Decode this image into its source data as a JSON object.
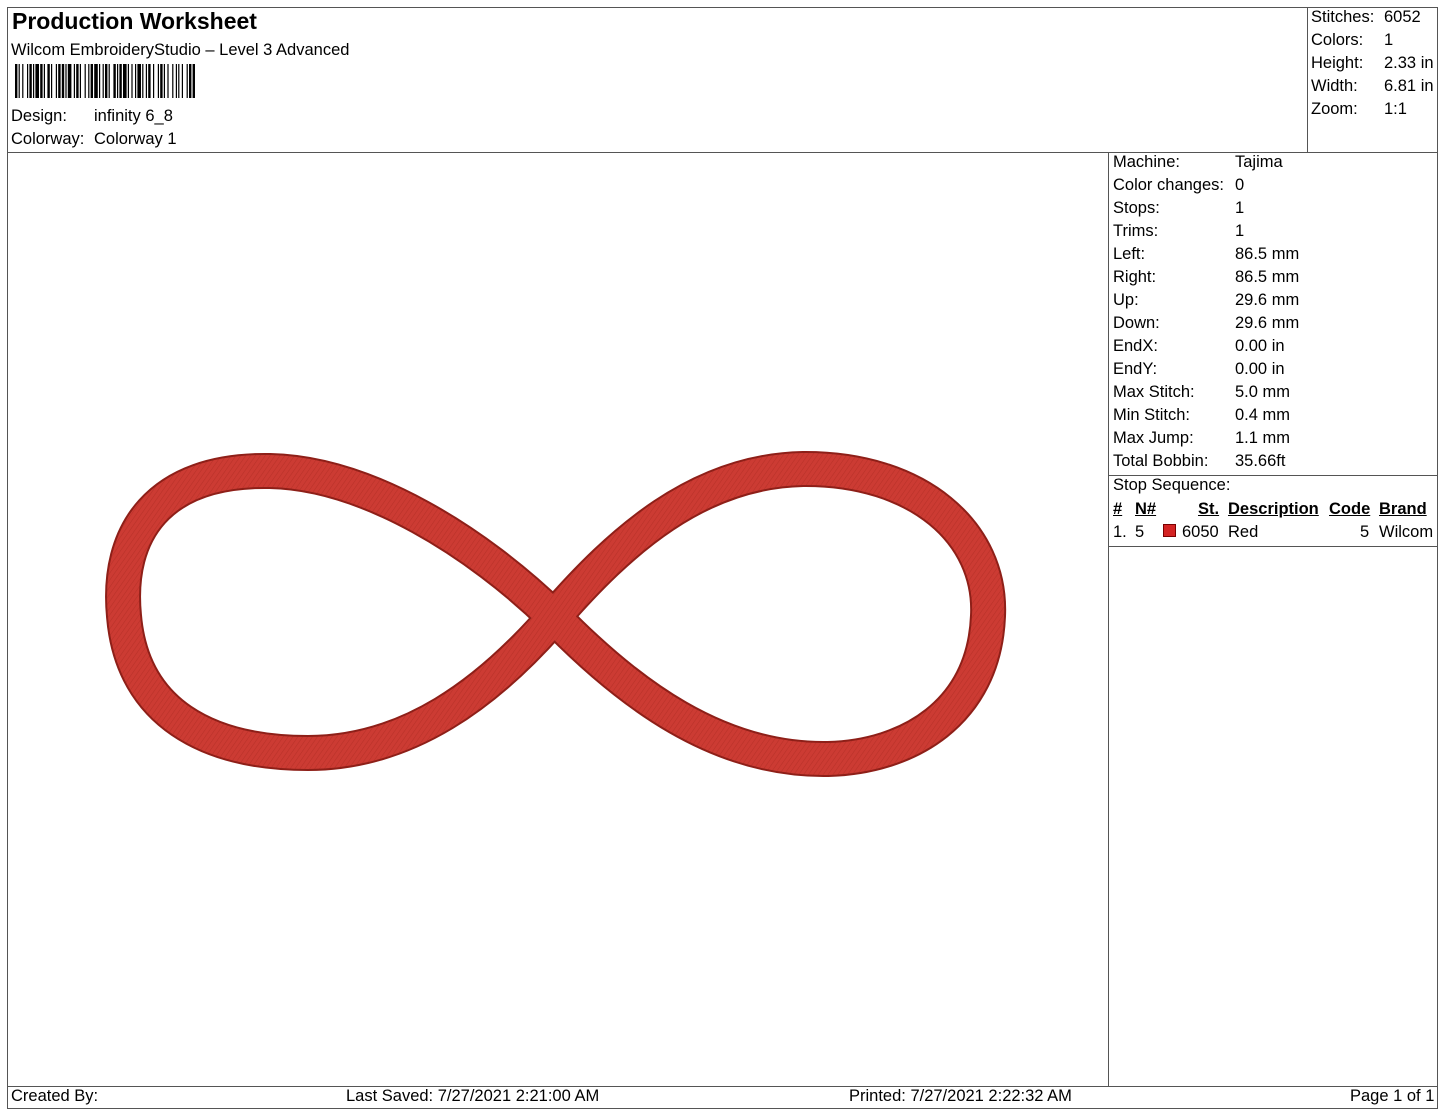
{
  "header": {
    "title": "Production Worksheet",
    "subtitle": "Wilcom EmbroideryStudio – Level 3 Advanced",
    "design_label": "Design:",
    "design_value": "infinity 6_8",
    "colorway_label": "Colorway:",
    "colorway_value": "Colorway 1"
  },
  "summary": [
    {
      "label": "Stitches:",
      "value": "6052"
    },
    {
      "label": "Colors:",
      "value": "1"
    },
    {
      "label": "Height:",
      "value": "2.33 in"
    },
    {
      "label": "Width:",
      "value": "6.81 in"
    },
    {
      "label": "Zoom:",
      "value": "1:1"
    }
  ],
  "details": [
    {
      "label": "Machine:",
      "value": "Tajima"
    },
    {
      "label": "Color changes:",
      "value": "0"
    },
    {
      "label": "Stops:",
      "value": "1"
    },
    {
      "label": "Trims:",
      "value": "1"
    },
    {
      "label": "Left:",
      "value": "86.5 mm"
    },
    {
      "label": "Right:",
      "value": "86.5 mm"
    },
    {
      "label": "Up:",
      "value": "29.6 mm"
    },
    {
      "label": "Down:",
      "value": "29.6 mm"
    },
    {
      "label": "EndX:",
      "value": "0.00 in"
    },
    {
      "label": "EndY:",
      "value": "0.00 in"
    },
    {
      "label": "Max Stitch:",
      "value": "5.0 mm"
    },
    {
      "label": "Min Stitch:",
      "value": "0.4 mm"
    },
    {
      "label": "Max Jump:",
      "value": "1.1 mm"
    },
    {
      "label": "Total Bobbin:",
      "value": "35.66ft"
    }
  ],
  "stop_sequence": {
    "title": "Stop Sequence:",
    "headers": [
      "#",
      "N#",
      "St.",
      "Description",
      "Code",
      "Brand"
    ],
    "rows": [
      {
        "num": "1.",
        "n": "5",
        "st": "6050",
        "description": "Red",
        "code": "5",
        "brand": "Wilcom",
        "color": "#d42323"
      }
    ]
  },
  "design": {
    "thread_color": "#cc3b33"
  },
  "footer": {
    "created_by": "Created By:",
    "last_saved": "Last Saved: 7/27/2021 2:21:00 AM",
    "printed": "Printed: 7/27/2021 2:22:32 AM",
    "page": "Page 1 of 1"
  }
}
